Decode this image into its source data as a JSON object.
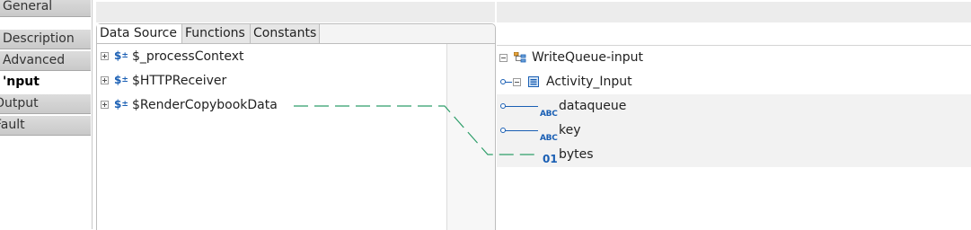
{
  "left_tabs": [
    {
      "label": "General"
    },
    {
      "label": "Description"
    },
    {
      "label": "Advanced"
    },
    {
      "label": "'nput"
    },
    {
      "label": "Output"
    },
    {
      "label": "Fault"
    }
  ],
  "middle": {
    "tabs": [
      {
        "label": "Data Source"
      },
      {
        "label": "Functions"
      },
      {
        "label": "Constants"
      }
    ],
    "source_items": [
      {
        "label": "$_processContext",
        "icon": "dollar-variable-icon"
      },
      {
        "label": "$HTTPReceiver",
        "icon": "dollar-variable-icon"
      },
      {
        "label": "$RenderCopybookData",
        "icon": "dollar-variable-icon"
      }
    ]
  },
  "right": {
    "tree": [
      {
        "label": "WriteQueue-input",
        "icon": "schema-root-icon"
      },
      {
        "label": "Activity_Input",
        "icon": "complex-type-icon"
      },
      {
        "label": "dataqueue",
        "icon": "string-type-icon",
        "type_text": "ABC"
      },
      {
        "label": "key",
        "icon": "string-type-icon",
        "type_text": "ABC"
      },
      {
        "label": "bytes",
        "icon": "binary-type-icon",
        "type_text": "01"
      }
    ]
  },
  "colors": {
    "mapping_line": "#2e9e6a",
    "accent": "#1a5fb4"
  }
}
